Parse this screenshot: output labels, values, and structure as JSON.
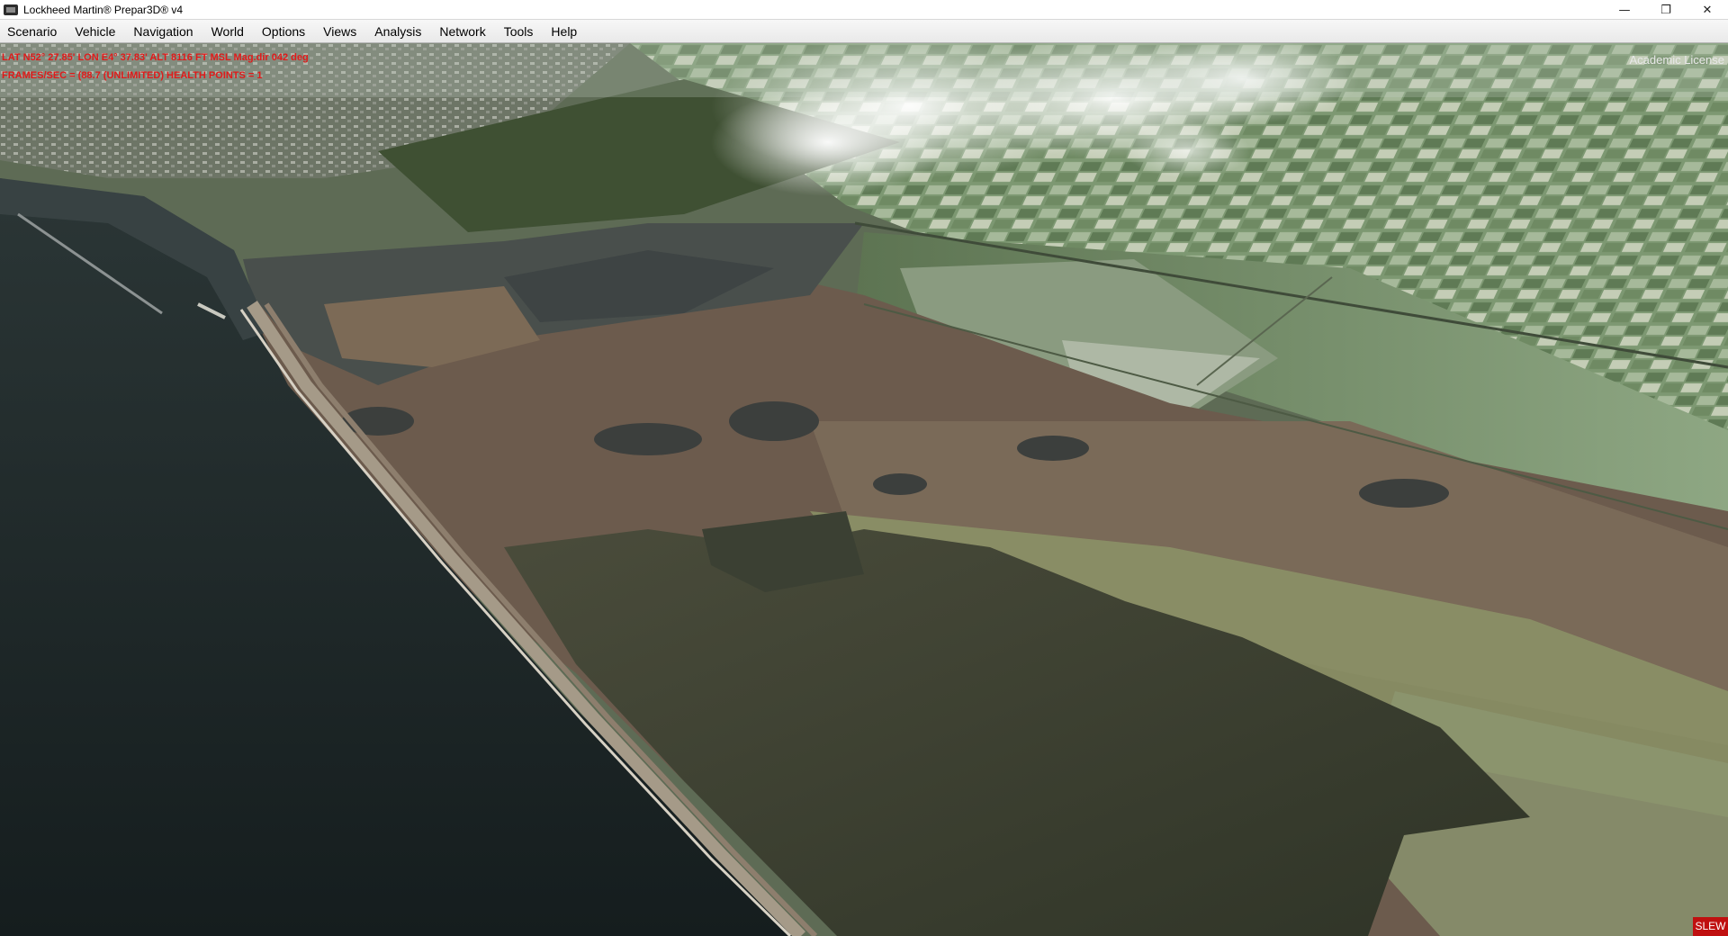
{
  "window": {
    "title": "Lockheed Martin® Prepar3D® v4",
    "controls": {
      "minimize": "—",
      "restore": "❐",
      "close": "✕"
    }
  },
  "menu": {
    "items": [
      {
        "label": "Scenario"
      },
      {
        "label": "Vehicle"
      },
      {
        "label": "Navigation"
      },
      {
        "label": "World"
      },
      {
        "label": "Options"
      },
      {
        "label": "Views"
      },
      {
        "label": "Analysis"
      },
      {
        "label": "Network"
      },
      {
        "label": "Tools"
      },
      {
        "label": "Help"
      }
    ]
  },
  "hud": {
    "line1": "LAT N52° 27.85'  LON E4° 37.83'  ALT 8116 FT MSL  Mag.dir 042 deg",
    "line2": "FRAMES/SEC = (88.7  (UNLIMITED)  HEALTH POINTS = 1",
    "color": "#e11a1a"
  },
  "overlay": {
    "license": "Academic License",
    "slew": "SLEW"
  },
  "colors": {
    "sea": "#1f2a2a",
    "lagoon": "#3d4233",
    "marsh": "#6b5a4c",
    "fields": "#6e8a62",
    "slew_bg": "#c01010"
  }
}
